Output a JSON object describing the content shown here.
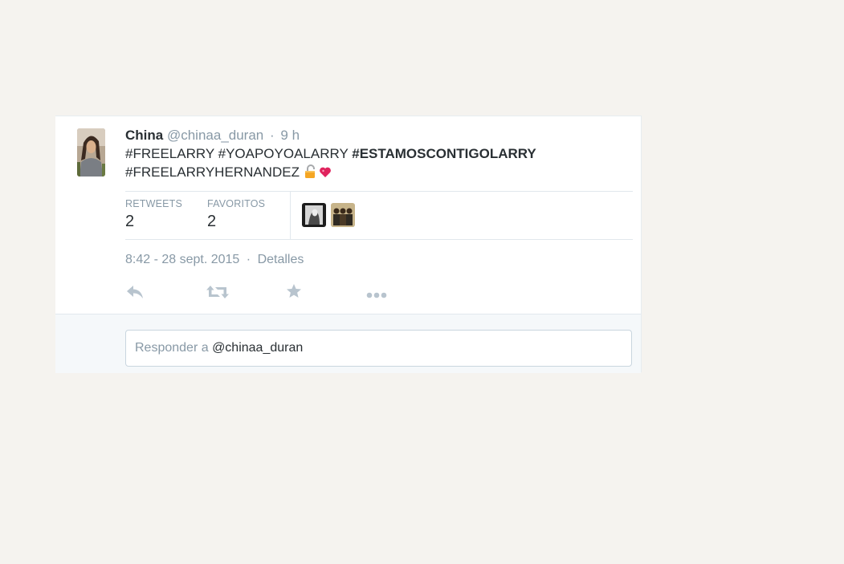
{
  "tweet": {
    "fullname": "China",
    "handle": "@chinaa_duran",
    "separator": "·",
    "time": "9 h",
    "hashtags_line1": [
      "#FREELARRY",
      "#YOAPOYOALARRY",
      "#ESTAMOSCONTIGOLARRY"
    ],
    "hashtags_line2": [
      "#FREELARRYHERNANDEZ"
    ],
    "emoji": [
      "lock-open-emoji",
      "heart-emoji"
    ]
  },
  "stats": {
    "retweets_label": "RETWEETS",
    "retweets_value": "2",
    "favorites_label": "FAVORITOS",
    "favorites_value": "2",
    "favoriter_avatars": [
      "avatar-bw-photo",
      "avatar-group-photo"
    ]
  },
  "meta": {
    "timestamp": "8:42 - 28 sept. 2015",
    "separator": "·",
    "details_link": "Detalles"
  },
  "actions": [
    "reply-icon",
    "retweet-icon",
    "favorite-star-icon",
    "more-dots-icon"
  ],
  "reply": {
    "prefix": "Responder a ",
    "mention": "@chinaa_duran"
  },
  "colors": {
    "page_background": "#f5f3ef",
    "text_primary": "#292f33",
    "text_secondary": "#8899a6",
    "icon_gray": "#b8c4ce",
    "heart": "#e0245e"
  }
}
